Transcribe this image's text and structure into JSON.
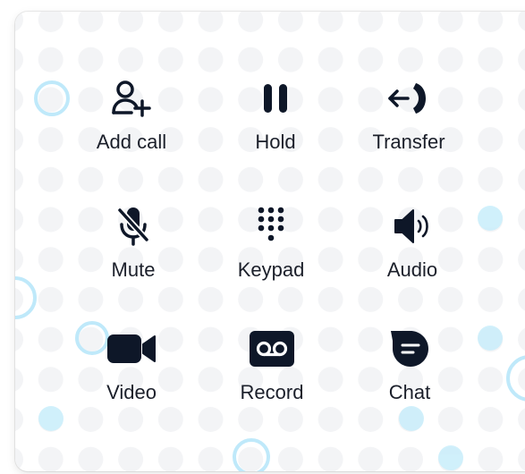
{
  "call_controls": {
    "add_call": {
      "label": "Add call",
      "icon": "add-user-icon"
    },
    "hold": {
      "label": "Hold",
      "icon": "pause-icon"
    },
    "transfer": {
      "label": "Transfer",
      "icon": "transfer-icon"
    },
    "mute": {
      "label": "Mute",
      "icon": "microphone-off-icon"
    },
    "keypad": {
      "label": "Keypad",
      "icon": "dialpad-icon"
    },
    "audio": {
      "label": "Audio",
      "icon": "speaker-icon"
    },
    "video": {
      "label": "Video",
      "icon": "video-camera-icon"
    },
    "record": {
      "label": "Record",
      "icon": "voicemail-icon"
    },
    "chat": {
      "label": "Chat",
      "icon": "chat-bubble-icon"
    }
  },
  "colors": {
    "icon": "#0e1728",
    "text": "#1b1f2a",
    "dot": "#f3f4f6",
    "accent_dot": "#c9eefb",
    "ring": "#bfe9fa"
  }
}
